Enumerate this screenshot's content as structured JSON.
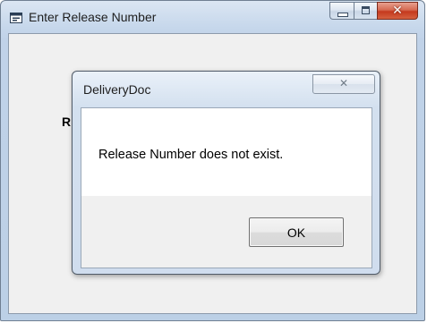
{
  "window": {
    "title": "Enter Release Number",
    "icon": "app-window-icon",
    "caption_buttons": [
      "minimize-icon",
      "maximize-icon",
      "close-icon"
    ],
    "partial_label": "R"
  },
  "dialog": {
    "title": "DeliveryDoc",
    "message": "Release Number does not exist.",
    "ok_label": "OK",
    "close_icon": "close-icon"
  },
  "colors": {
    "close_button": "#c5391e",
    "frame": "#c0d2e8",
    "content_bg": "#ffffff",
    "footer_bg": "#f0f0f0"
  }
}
